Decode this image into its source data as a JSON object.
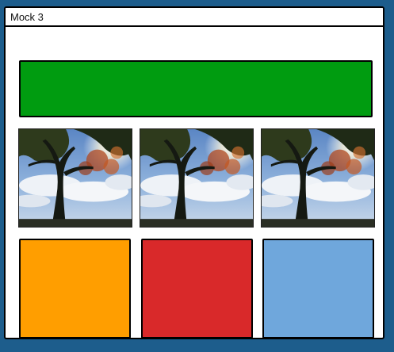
{
  "window": {
    "title": "Mock 3"
  },
  "hero_block": {
    "color": "#009c10"
  },
  "photos": [
    {
      "subject": "tree-silhouette-against-sky"
    },
    {
      "subject": "tree-silhouette-against-sky"
    },
    {
      "subject": "tree-silhouette-against-sky"
    }
  ],
  "swatches": [
    {
      "color": "#ff9e00"
    },
    {
      "color": "#d9292a"
    },
    {
      "color": "#6fa7dc"
    }
  ],
  "theme": {
    "background": "#1d5d8c"
  }
}
